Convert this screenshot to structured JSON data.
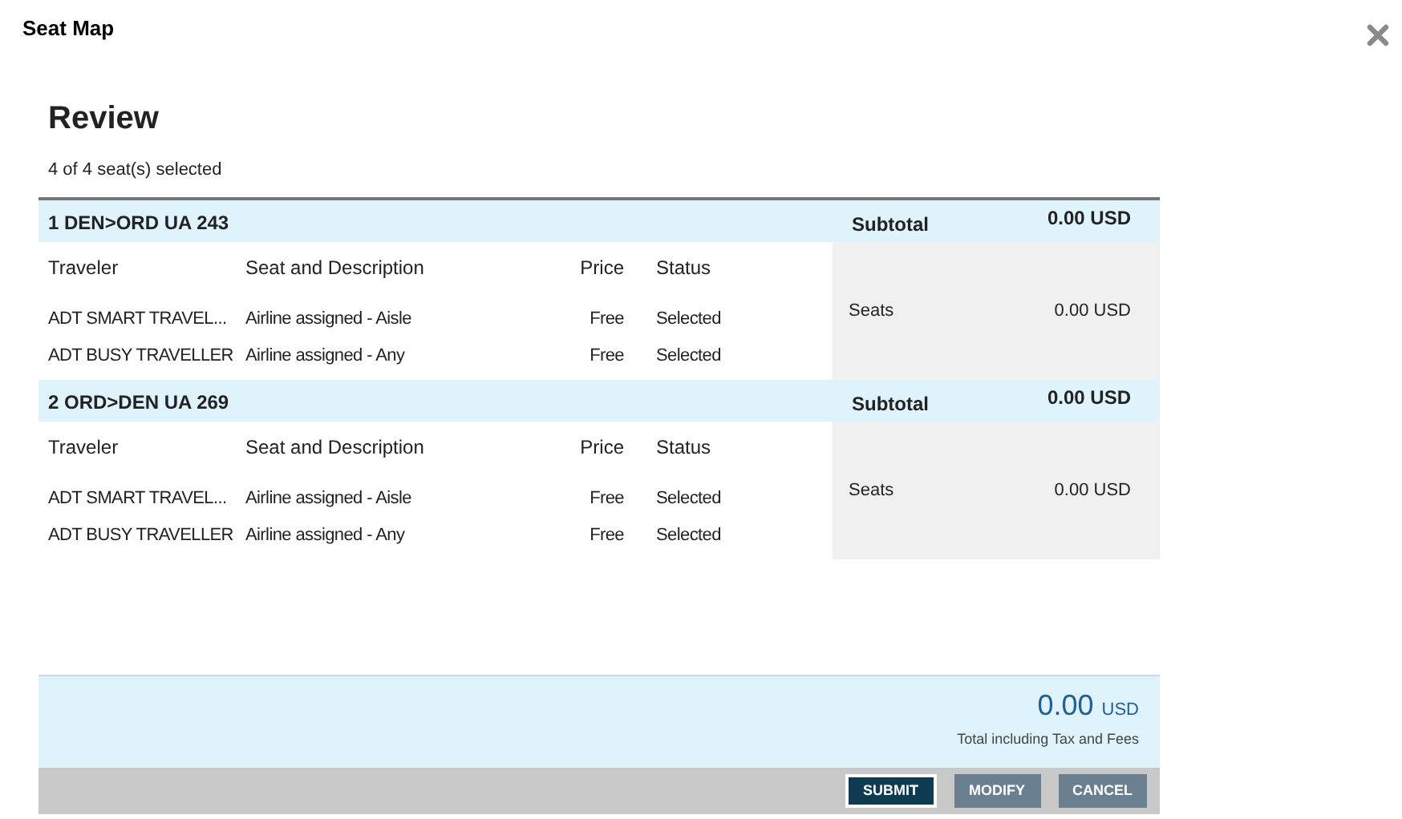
{
  "window": {
    "title": "Seat Map"
  },
  "review": {
    "heading": "Review",
    "summary": "4 of 4 seat(s) selected"
  },
  "segments": [
    {
      "title": "1 DEN>ORD UA 243",
      "columns": [
        "Traveler",
        "Seat and Description",
        "Price",
        "Status"
      ],
      "subtotal_label": "Subtotal",
      "subtotal": "0.00 USD",
      "seats_label": "Seats",
      "seats_amount": "0.00 USD",
      "rows": [
        {
          "traveler": "ADT SMART TRAVEL...",
          "seat": "Airline assigned - Aisle",
          "price": "Free",
          "status": "Selected"
        },
        {
          "traveler": "ADT BUSY TRAVELLER",
          "seat": "Airline assigned - Any",
          "price": "Free",
          "status": "Selected"
        }
      ]
    },
    {
      "title": "2 ORD>DEN UA 269",
      "columns": [
        "Traveler",
        "Seat and Description",
        "Price",
        "Status"
      ],
      "subtotal_label": "Subtotal",
      "subtotal": "0.00 USD",
      "seats_label": "Seats",
      "seats_amount": "0.00 USD",
      "rows": [
        {
          "traveler": "ADT SMART TRAVEL...",
          "seat": "Airline assigned - Aisle",
          "price": "Free",
          "status": "Selected"
        },
        {
          "traveler": "ADT BUSY TRAVELLER",
          "seat": "Airline assigned - Any",
          "price": "Free",
          "status": "Selected"
        }
      ]
    }
  ],
  "total": {
    "amount": "0.00",
    "currency": "USD",
    "note": "Total including Tax and Fees"
  },
  "buttons": [
    {
      "label": "SUBMIT",
      "kind": "primary"
    },
    {
      "label": "MODIFY",
      "kind": "secondary"
    },
    {
      "label": "CANCEL",
      "kind": "secondary"
    }
  ]
}
